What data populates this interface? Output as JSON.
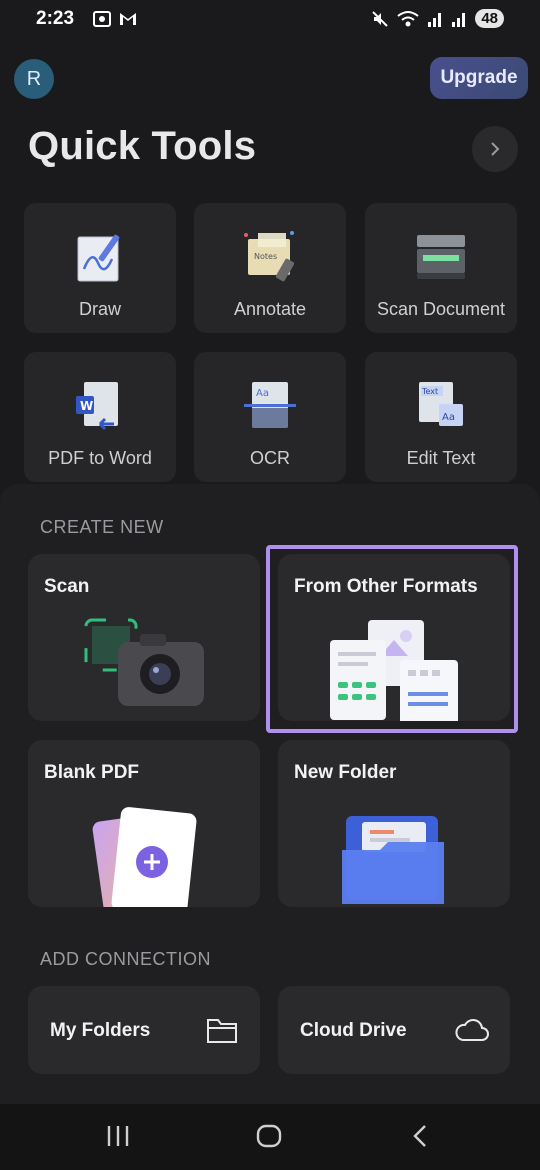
{
  "status": {
    "time": "2:23",
    "battery": "48"
  },
  "header": {
    "avatar_initial": "R",
    "upgrade_label": "Upgrade",
    "title": "Quick Tools"
  },
  "tools": [
    {
      "label": "Draw",
      "icon": "draw-icon"
    },
    {
      "label": "Annotate",
      "icon": "annotate-icon"
    },
    {
      "label": "Scan Document",
      "icon": "scanner-icon"
    },
    {
      "label": "PDF to Word",
      "icon": "pdf-to-word-icon"
    },
    {
      "label": "OCR",
      "icon": "ocr-icon"
    },
    {
      "label": "Edit Text",
      "icon": "edit-text-icon"
    }
  ],
  "annotate_note_text": "Notes",
  "create_new": {
    "section_label": "CREATE NEW",
    "scan_label": "Scan",
    "formats_label": "From Other Formats",
    "blank_label": "Blank PDF",
    "folder_label": "New Folder"
  },
  "add_connection": {
    "section_label": "ADD CONNECTION",
    "my_folders_label": "My Folders",
    "cloud_drive_label": "Cloud Drive"
  },
  "colors": {
    "accent": "#b18ff0",
    "upgrade_bg": "#4a4f8f",
    "background": "#1a1a1c"
  }
}
